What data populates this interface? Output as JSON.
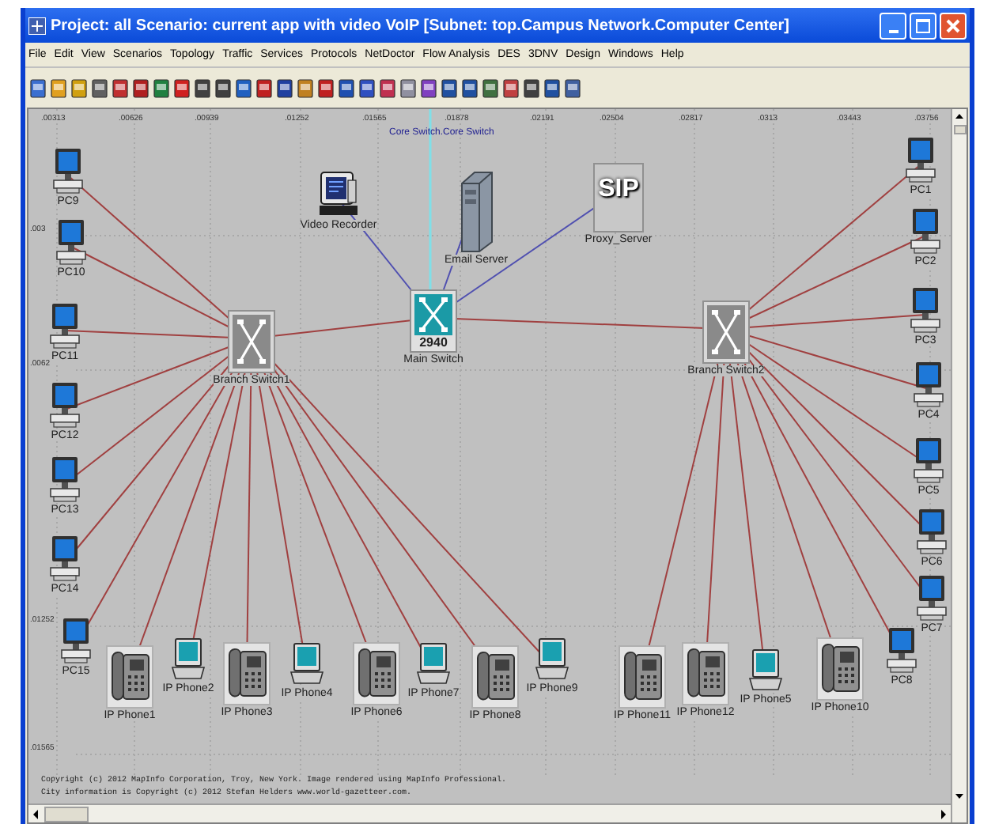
{
  "window": {
    "title": "Project: all Scenario: current app with video VoIP  [Subnet: top.Campus Network.Computer Center]"
  },
  "menu": [
    "File",
    "Edit",
    "View",
    "Scenarios",
    "Topology",
    "Traffic",
    "Services",
    "Protocols",
    "NetDoctor",
    "Flow Analysis",
    "DES",
    "3DNV",
    "Design",
    "Windows",
    "Help"
  ],
  "ruler": {
    "top": [
      ".00313",
      ".00626",
      ".00939",
      ".01252",
      ".01565",
      ".01878",
      ".02191",
      ".02504",
      ".02817",
      ".0313",
      ".03443",
      ".03756"
    ],
    "left": [
      ".003",
      ".0062",
      ".01252",
      ".01565"
    ]
  },
  "uplink": {
    "label": "Core Switch.Core Switch"
  },
  "nodes": [
    {
      "kind": "pc",
      "label": "PC9"
    },
    {
      "kind": "pc",
      "label": "PC10"
    },
    {
      "kind": "pc",
      "label": "PC11"
    },
    {
      "kind": "pc",
      "label": "PC12"
    },
    {
      "kind": "pc",
      "label": "PC13"
    },
    {
      "kind": "pc",
      "label": "PC14"
    },
    {
      "kind": "pc",
      "label": "PC15"
    },
    {
      "kind": "recorder",
      "label": "Video Recorder"
    },
    {
      "kind": "server",
      "label": "Email Server"
    },
    {
      "kind": "sip-server",
      "label": "Proxy_Server",
      "icon_text": "SIP"
    },
    {
      "kind": "core-switch",
      "label": "Main Switch",
      "model": "2940"
    },
    {
      "kind": "switch",
      "label": "Branch Switch1"
    },
    {
      "kind": "switch",
      "label": "Branch Switch2"
    },
    {
      "kind": "pc",
      "label": "PC1"
    },
    {
      "kind": "pc",
      "label": "PC2"
    },
    {
      "kind": "pc",
      "label": "PC3"
    },
    {
      "kind": "pc",
      "label": "PC4"
    },
    {
      "kind": "pc",
      "label": "PC5"
    },
    {
      "kind": "pc",
      "label": "PC6"
    },
    {
      "kind": "pc",
      "label": "PC7"
    },
    {
      "kind": "pc",
      "label": "PC8"
    },
    {
      "kind": "phone",
      "label": "IP Phone1"
    },
    {
      "kind": "laptop",
      "label": "IP Phone2"
    },
    {
      "kind": "phone",
      "label": "IP Phone3"
    },
    {
      "kind": "laptop",
      "label": "IP Phone4"
    },
    {
      "kind": "phone",
      "label": "IP Phone6"
    },
    {
      "kind": "laptop",
      "label": "IP Phone7"
    },
    {
      "kind": "phone",
      "label": "IP Phone8"
    },
    {
      "kind": "laptop",
      "label": "IP Phone9"
    },
    {
      "kind": "phone",
      "label": "IP Phone11"
    },
    {
      "kind": "phone",
      "label": "IP Phone12"
    },
    {
      "kind": "laptop",
      "label": "IP Phone5"
    },
    {
      "kind": "phone",
      "label": "IP Phone10"
    }
  ],
  "copyright": [
    "Copyright (c) 2012 MapInfo Corporation, Troy, New York. Image rendered using MapInfo Professional.",
    "City information is Copyright (c) 2012 Stefan Helders www.world-gazetteer.com."
  ]
}
